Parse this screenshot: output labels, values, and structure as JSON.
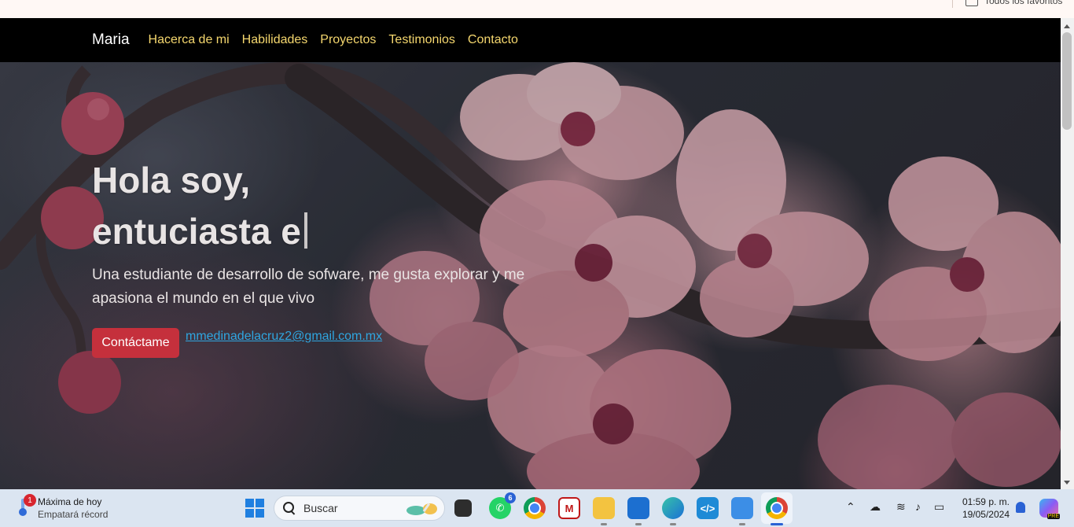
{
  "browser": {
    "bookmarks_folder_label": "Todos los favoritos"
  },
  "navbar": {
    "brand": "Maria",
    "links": [
      "Hacerca de mi",
      "Habilidades",
      "Proyectos",
      "Testimonios",
      "Contacto"
    ],
    "link_color": "#f5d76e",
    "background": "#000000"
  },
  "hero": {
    "title_line1": "Hola soy,",
    "title_line2": "entuciasta e",
    "description": "Una estudiante de desarrollo de sofware, me gusta explorar y me apasiona el mundo en el que vivo",
    "contact_button": "Contáctame",
    "email": "mmedinadelacruz2@gmail.com.mx",
    "button_color": "#c5303c",
    "background_image": "pink-cherry-blossom-branch"
  },
  "taskbar": {
    "weather_title": "Máxima de hoy",
    "weather_subtitle": "Empatará récord",
    "weather_badge": "1",
    "search_placeholder": "Buscar",
    "whatsapp_badge": "6",
    "apps": [
      "windows-start-icon",
      "task-view-icon",
      "whatsapp-icon",
      "chrome-icon",
      "mcafee-icon",
      "file-explorer-icon",
      "microsoft-store-icon",
      "edge-icon",
      "vscode-icon",
      "notepad-icon",
      "chrome-active-icon"
    ],
    "time": "01:59 p. m.",
    "date": "19/05/2024",
    "copilot_badge": "PRE"
  }
}
